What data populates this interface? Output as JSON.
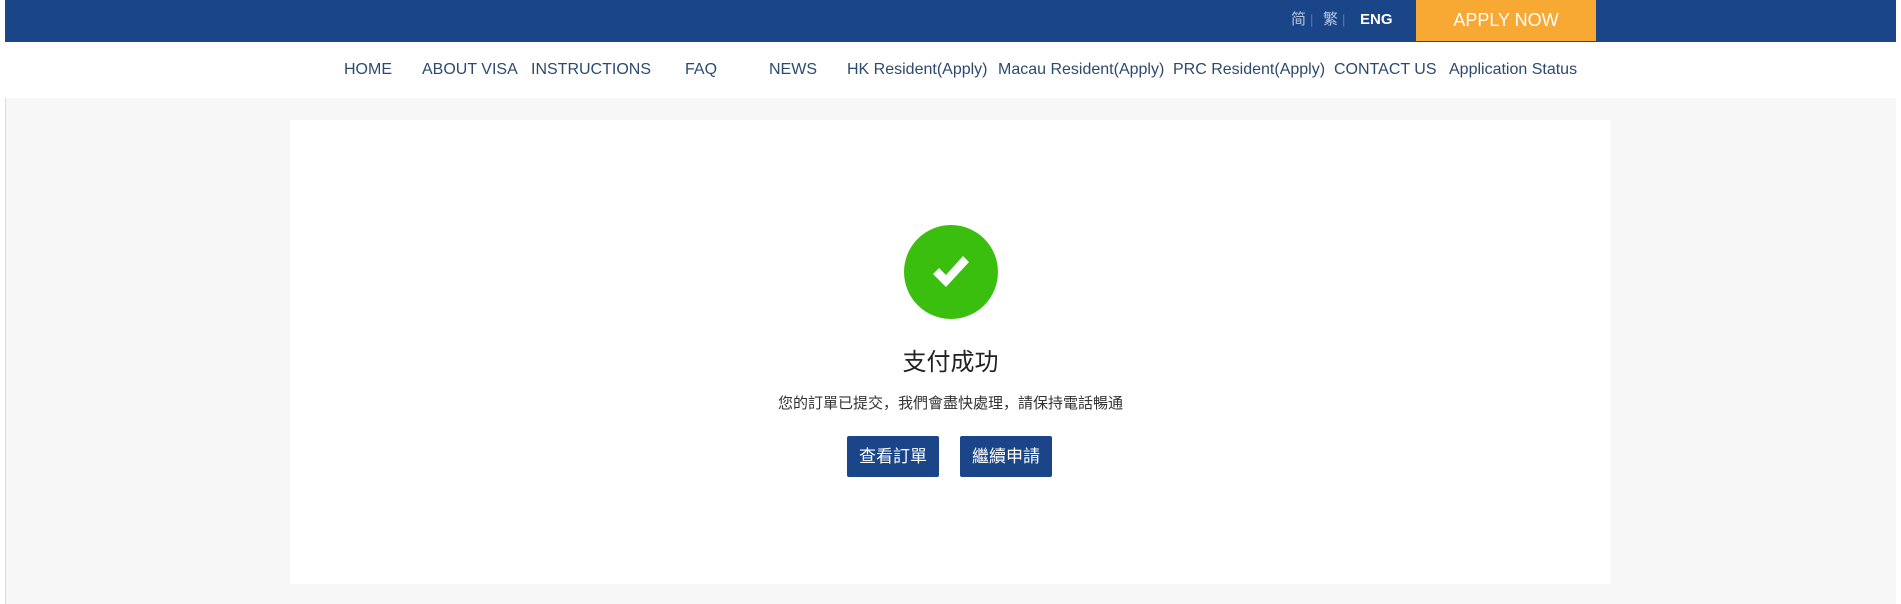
{
  "header": {
    "languages": [
      {
        "label": "简",
        "active": false
      },
      {
        "label": "繁",
        "active": false
      },
      {
        "label": "ENG",
        "active": true
      }
    ],
    "separator": "|",
    "apply_label": "APPLY NOW"
  },
  "nav": {
    "items": [
      "HOME",
      "ABOUT VISA",
      "INSTRUCTIONS",
      "FAQ",
      "NEWS",
      "HK Resident(Apply)",
      "Macau Resident(Apply)",
      "PRC Resident(Apply)",
      "CONTACT US",
      "Application Status"
    ]
  },
  "result": {
    "icon": "check-circle-icon",
    "title": "支付成功",
    "message": "您的訂單已提交，我們會盡快處理，請保持電話暢通",
    "buttons": {
      "view_order": "查看訂單",
      "continue_apply": "繼續申請"
    }
  },
  "colors": {
    "brand": "#1b4589",
    "accent": "#f8a933",
    "success": "#3bbf0f"
  }
}
